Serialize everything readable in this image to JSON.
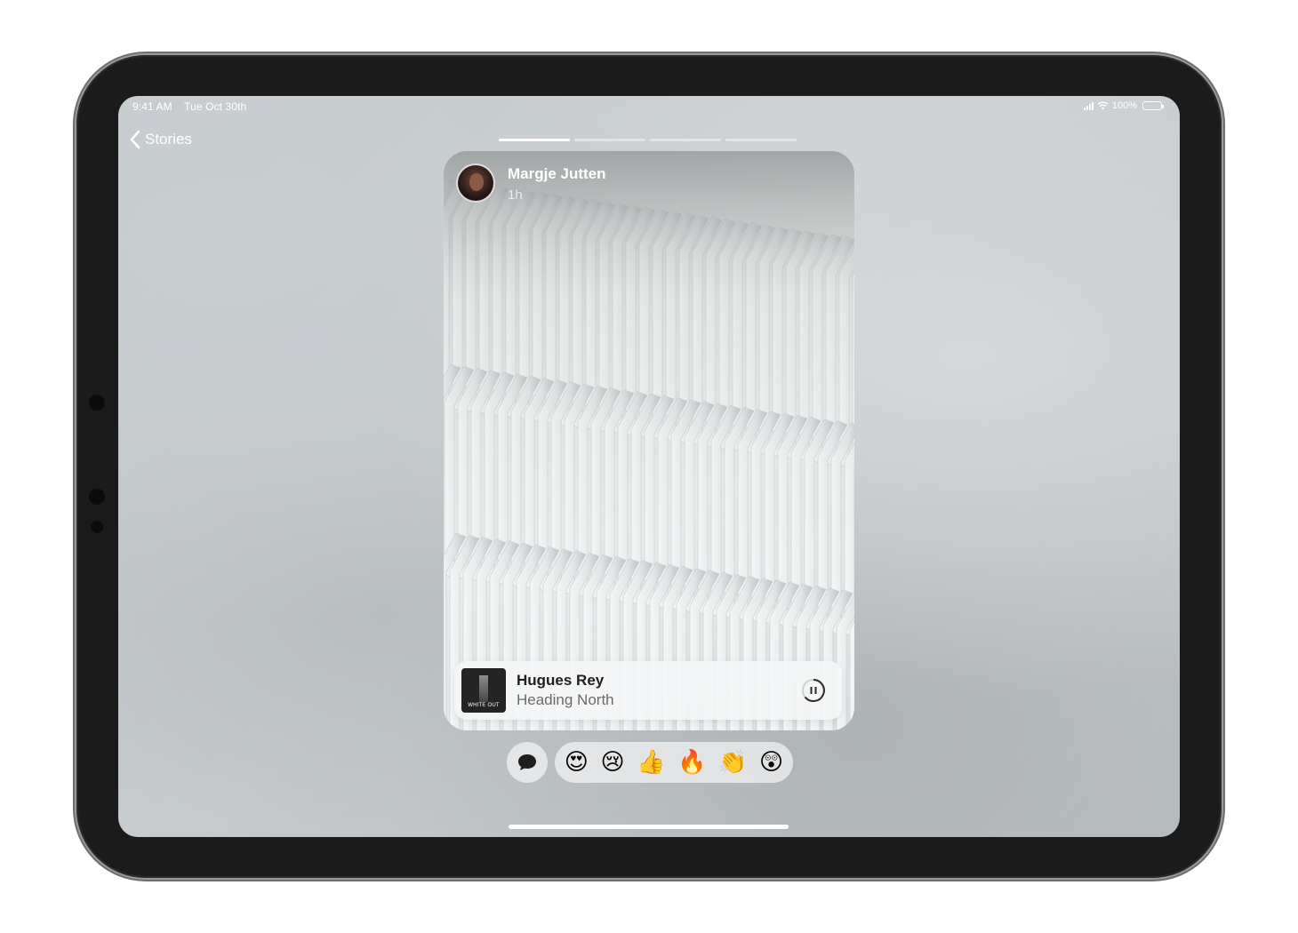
{
  "status_bar": {
    "time": "9:41 AM",
    "date": "Tue Oct 30th",
    "battery": "100%"
  },
  "nav": {
    "back_label": "Stories"
  },
  "story": {
    "segments_total": 4,
    "active_segment": 1,
    "poster_name": "Margje Jutten",
    "posted_ago": "1h"
  },
  "music": {
    "artist": "Hugues Rey",
    "song": "Heading North",
    "album_caption": "WHITE OUT",
    "state": "playing"
  },
  "reactions": [
    {
      "name": "heart-eyes",
      "glyph": "😍"
    },
    {
      "name": "crying",
      "glyph": "😢"
    },
    {
      "name": "thumbs-up",
      "glyph": "👍"
    },
    {
      "name": "fire",
      "glyph": "🔥"
    },
    {
      "name": "clapping",
      "glyph": "👏"
    },
    {
      "name": "astonished",
      "glyph": "😲"
    }
  ],
  "colors": {
    "accent": "#ffffff",
    "frame": "#1b1b1c"
  }
}
